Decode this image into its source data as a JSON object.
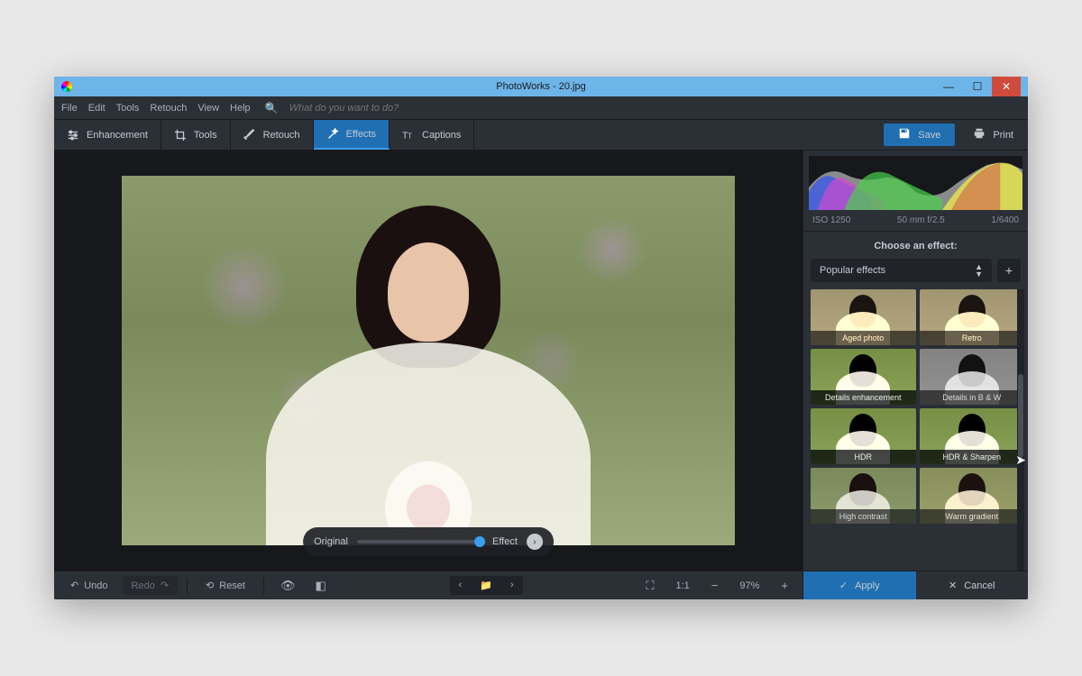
{
  "titlebar": {
    "title": "PhotoWorks - 20.jpg"
  },
  "menubar": {
    "items": [
      "File",
      "Edit",
      "Tools",
      "Retouch",
      "View",
      "Help"
    ],
    "search_placeholder": "What do you want to do?"
  },
  "toolbar": {
    "tabs": [
      {
        "label": "Enhancement"
      },
      {
        "label": "Tools"
      },
      {
        "label": "Retouch"
      },
      {
        "label": "Effects"
      },
      {
        "label": "Captions"
      }
    ],
    "save": "Save",
    "print": "Print"
  },
  "slider": {
    "left": "Original",
    "right": "Effect"
  },
  "bottombar": {
    "undo": "Undo",
    "redo": "Redo",
    "reset": "Reset",
    "ratio": "1:1",
    "zoom": "97%"
  },
  "side": {
    "meta": {
      "iso": "ISO 1250",
      "lens": "50 mm f/2.5",
      "shutter": "1/6400"
    },
    "panel_title": "Choose an effect:",
    "category": "Popular effects",
    "effects": [
      "Aged photo",
      "Retro",
      "Details enhancement",
      "Details in B & W",
      "HDR",
      "HDR & Sharpen",
      "High contrast",
      "Warm gradient"
    ],
    "apply": "Apply",
    "cancel": "Cancel"
  }
}
